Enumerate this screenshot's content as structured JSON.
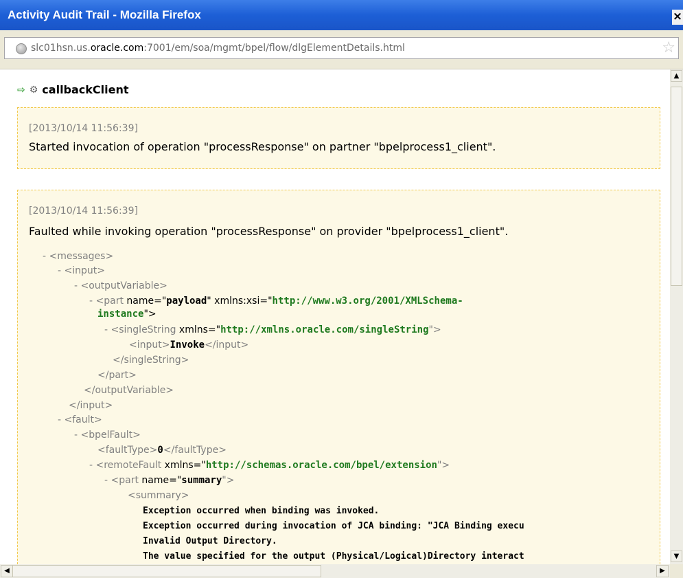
{
  "window": {
    "title": "Activity Audit Trail - Mozilla Firefox",
    "close_glyph": "×"
  },
  "address": {
    "url_prefix": "slc01hsn.us.",
    "url_domain": "oracle.com",
    "url_suffix": ":7001/em/soa/mgmt/bpel/flow/dlgElementDetails.html"
  },
  "page": {
    "heading": "callbackClient",
    "entries": [
      {
        "timestamp": "[2013/10/14 11:56:39]",
        "message": "Started invocation of operation \"processResponse\" on partner \"bpelprocess1_client\"."
      },
      {
        "timestamp": "[2013/10/14 11:56:39]",
        "message": "Faulted while invoking operation \"processResponse\" on provider \"bpelprocess1_client\"."
      }
    ],
    "xml": {
      "messages_open": "- <messages>",
      "input_open": "- <input>",
      "outputVariable_open": "- <outputVariable>",
      "part_prefix": "- <part ",
      "part_name_attr": "name=\"",
      "part_name_val": "payload",
      "part_xsi_attr": "\" xmlns:xsi=\"",
      "part_xsi_val": "http://www.w3.org/2001/XMLSchema-",
      "part_xsi_val2": "instance",
      "part_close_tag": "\">",
      "singleString_prefix": "- <singleString ",
      "singleString_attr": "xmlns=\"",
      "singleString_val": "http://xmlns.oracle.com/singleString",
      "singleString_end": "\">",
      "inner_input_open": "<input>",
      "inner_input_val": "Invoke",
      "inner_input_close": "</input>",
      "singleString_close": "</singleString>",
      "part_close": "</part>",
      "outputVariable_close": "</outputVariable>",
      "input_close": "</input>",
      "fault_open": "- <fault>",
      "bpelFault_open": "- <bpelFault>",
      "faultType_open": "<faultType>",
      "faultType_val": "0",
      "faultType_close": "</faultType>",
      "remoteFault_prefix": "- <remoteFault ",
      "remoteFault_attr": "xmlns=\"",
      "remoteFault_val": "http://schemas.oracle.com/bpel/extension",
      "remoteFault_end": "\">",
      "part2_prefix": "- <part ",
      "part2_attr": "name=\"",
      "part2_val": "summary",
      "part2_end": "\">",
      "summary_open": "<summary>",
      "summary_lines": [
        "Exception occurred when binding was invoked.",
        "Exception occurred during invocation of JCA binding: \"JCA Binding execu",
        "Invalid Output Directory.",
        "The value specified for the output (Physical/Logical)Directory interact"
      ]
    }
  },
  "scrollbars": {
    "up": "▲",
    "down": "▼",
    "left": "◀",
    "right": "▶"
  }
}
